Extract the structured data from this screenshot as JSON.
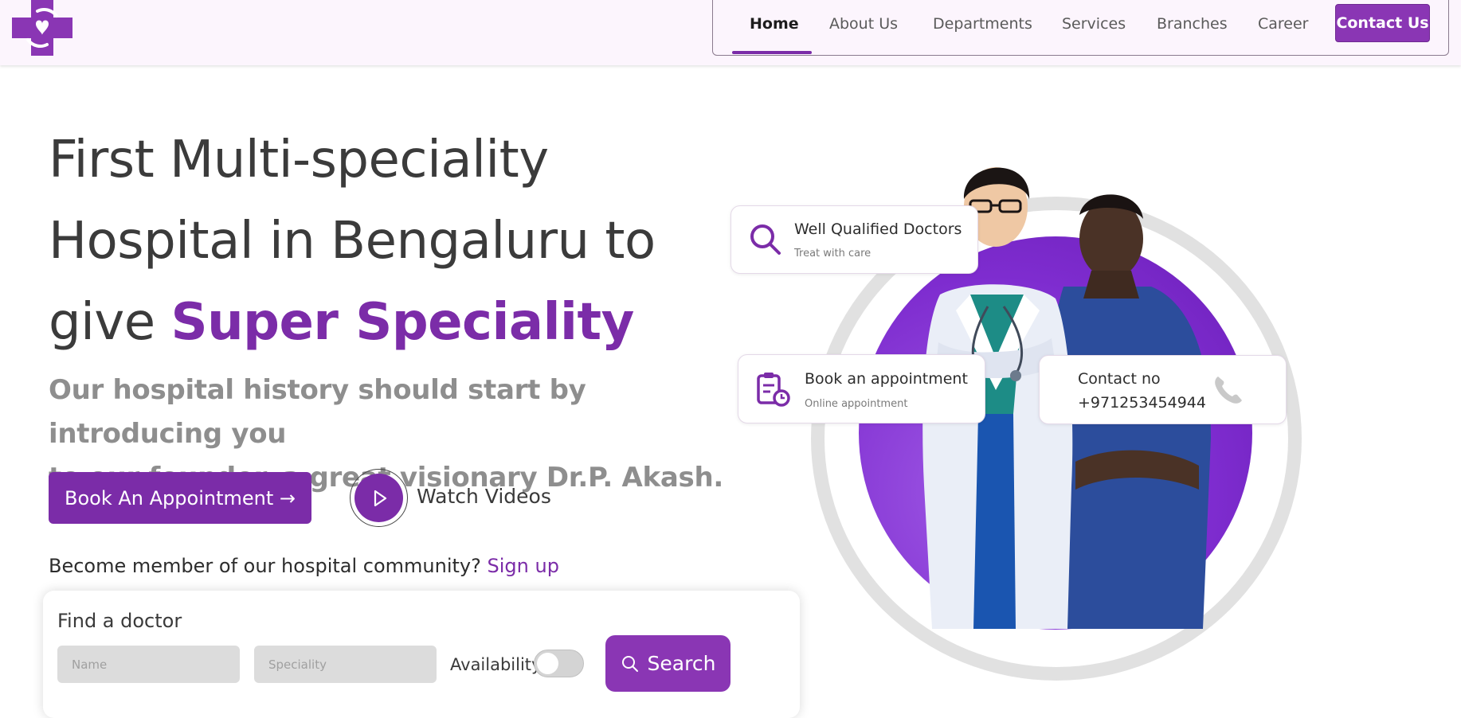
{
  "colors": {
    "brand": "#7b2ca8",
    "brand_button": "#8a36b4",
    "header_bg": "#fcf5fd",
    "input_bg": "#dcdcdc"
  },
  "header": {
    "logo_icon": "hospital-cross-heart-hands-icon",
    "nav": {
      "home": "Home",
      "about": "About Us",
      "departments": "Departments",
      "services": "Services",
      "branches": "Branches",
      "career": "Career",
      "contact": "Contact Us"
    },
    "active_item": "Home"
  },
  "hero": {
    "headline_line1": "First Multi-speciality",
    "headline_line2": "Hospital in Bengaluru to",
    "headline_give": "give ",
    "headline_highlight": "Super Speciality",
    "subtext_line1": "Our hospital history should start by introducing you",
    "subtext_line2": "to our founder, a great visionary Dr.P. Akash.",
    "book_button": "Book An Appointment →",
    "watch_label": "Watch Videos",
    "member_text": "Become member of our hospital community?",
    "signup_link": "Sign up"
  },
  "find_doctor": {
    "title": "Find a doctor",
    "name_placeholder": "Name",
    "speciality_placeholder": "Speciality",
    "availability_label": "Availability",
    "availability_on": false,
    "search_button": "Search"
  },
  "cards": {
    "doctors": {
      "title": "Well Qualified Doctors",
      "subtitle": "Treat with care",
      "icon": "search-icon"
    },
    "appointment": {
      "title": "Book an appointment",
      "subtitle": "Online appointment",
      "icon": "clipboard-clock-icon"
    },
    "contact": {
      "title": "Contact no",
      "number": "+971253454944",
      "icon": "phone-icon"
    }
  }
}
